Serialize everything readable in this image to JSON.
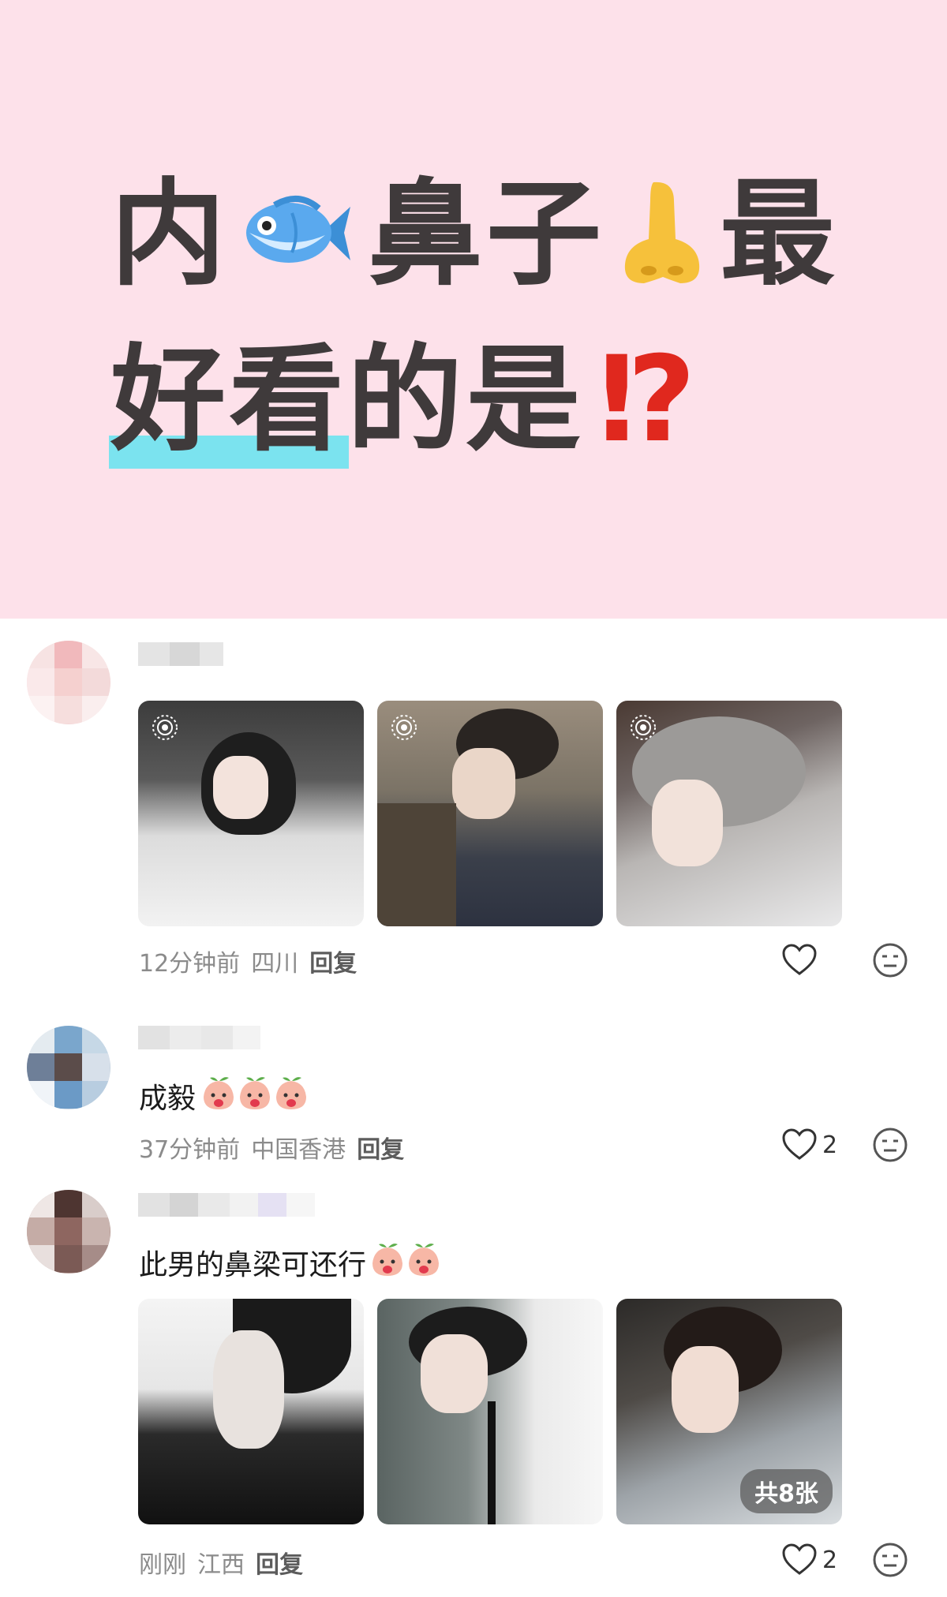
{
  "banner": {
    "line1_part1": "内",
    "line1_part2": "鼻子",
    "line1_part3": "最",
    "line2_highlight": "好看",
    "line2_rest": "的是",
    "line2_punct": "⁉"
  },
  "comments": [
    {
      "text": "",
      "time": "12分钟前",
      "location": "四川",
      "reply_label": "回复",
      "likes": ""
    },
    {
      "text": "成毅",
      "time": "37分钟前",
      "location": "中国香港",
      "reply_label": "回复",
      "likes": "2"
    },
    {
      "text": "此男的鼻梁可还行",
      "time": "刚刚",
      "location": "江西",
      "reply_label": "回复",
      "likes": "2",
      "image_count_badge": "共8张"
    }
  ],
  "icons": {
    "live_photo": "live-photo-icon",
    "fish": "fish-emoji-icon",
    "nose": "nose-emoji-icon",
    "peach": "peach-sticker-icon",
    "heart": "heart-icon",
    "meh": "meh-face-icon"
  },
  "colors": {
    "banner_bg": "#fde1ea",
    "highlight": "#7be3ef",
    "exclaim": "#e0281e"
  }
}
